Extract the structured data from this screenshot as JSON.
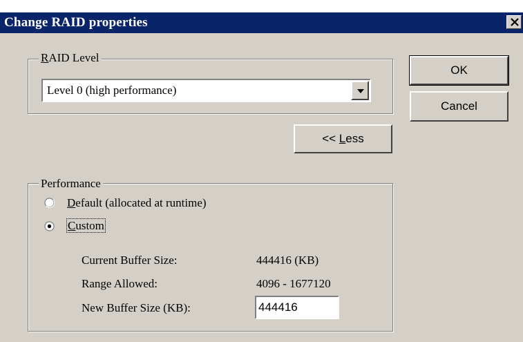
{
  "window": {
    "title": "Change RAID properties",
    "close_label": "×"
  },
  "raid_level": {
    "group_label_accel": "R",
    "group_label_rest": "AID Level",
    "selected": "Level 0 (high performance)"
  },
  "buttons": {
    "ok": "OK",
    "cancel": "Cancel",
    "less_prefix": "<< ",
    "less_accel": "L",
    "less_rest": "ess"
  },
  "performance": {
    "group_label": "Performance",
    "default_option_accel": "D",
    "default_option_rest": "efault (allocated at runtime)",
    "default_selected": false,
    "custom_option_accel": "C",
    "custom_option_rest": "ustom",
    "custom_selected": true,
    "current_buffer_label": "Current Buffer Size:",
    "current_buffer_value": "444416 (KB)",
    "range_label": "Range Allowed:",
    "range_value": "4096 - 1677120",
    "new_buffer_label": "New Buffer Size (KB):",
    "new_buffer_value": "444416"
  }
}
